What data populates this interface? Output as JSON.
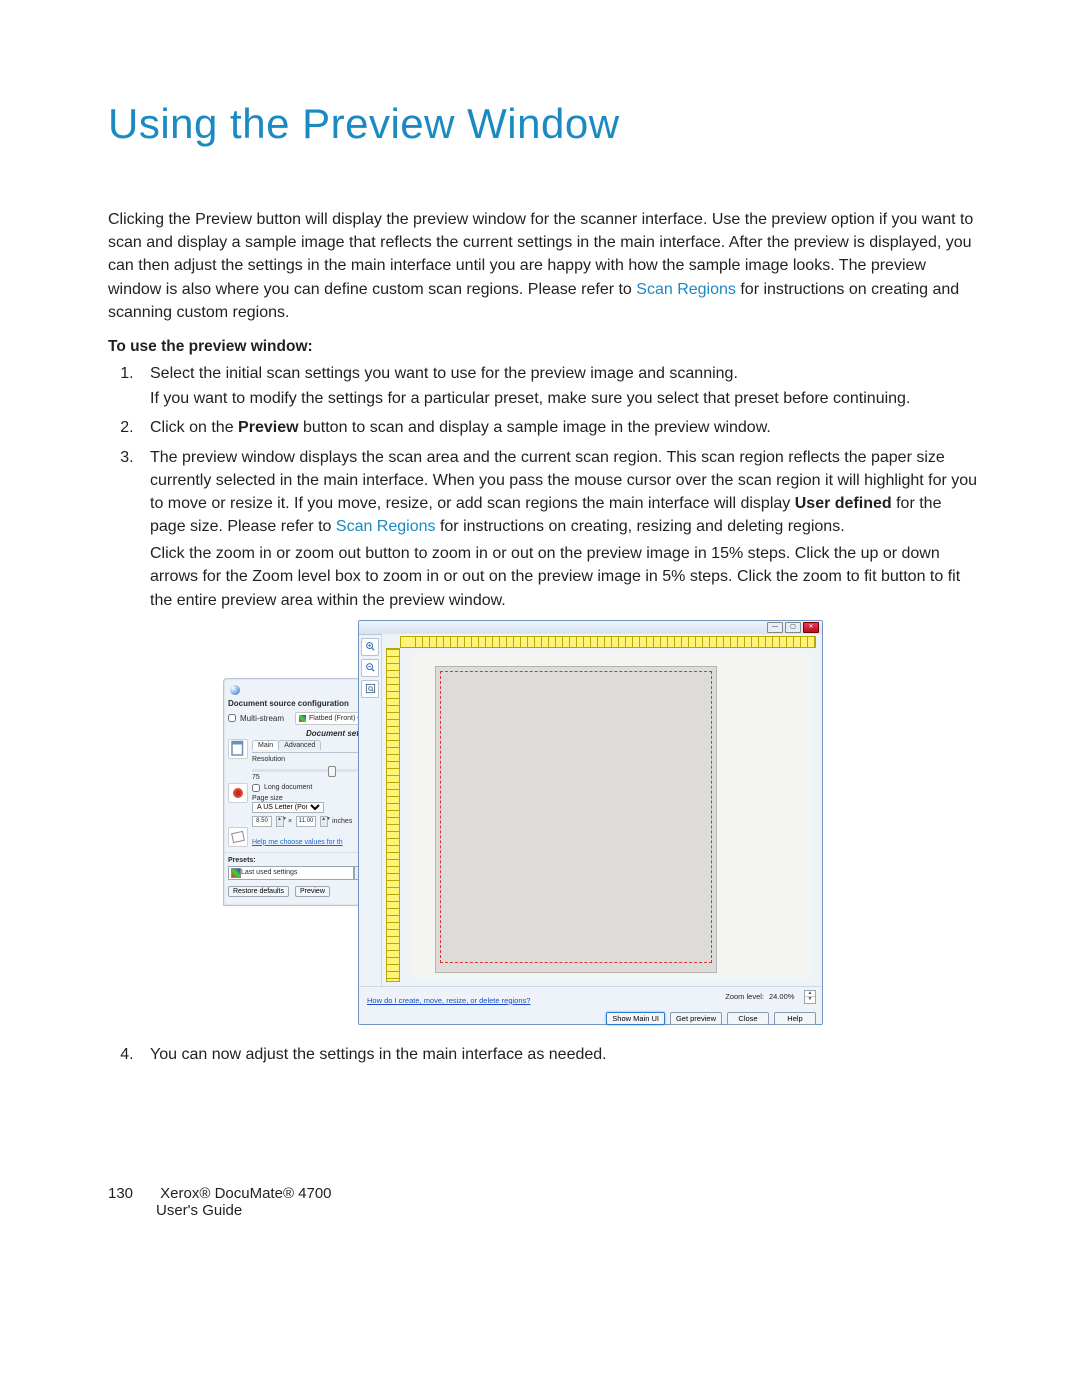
{
  "title": "Using the Preview Window",
  "intro": {
    "p1a": "Clicking the Preview button will display the preview window for the scanner interface. Use the preview option if you want to scan and display a sample image that reflects the current settings in the main interface. After the preview is displayed, you can then adjust the settings in the main interface until you are happy with how the sample image looks. The preview window is also where you can define custom scan regions. Please refer to ",
    "p1_link": "Scan Regions",
    "p1b": " for instructions on creating and scanning custom regions."
  },
  "sub_heading": "To use the preview window:",
  "steps": {
    "s1a": "Select the initial scan settings you want to use for the preview image and scanning.",
    "s1b": "If you want to modify the settings for a particular preset, make sure you select that preset before continuing.",
    "s2a": "Click on the ",
    "s2_bold": "Preview",
    "s2b": " button to scan and display a sample image in the preview window.",
    "s3a": "The preview window displays the scan area and the current scan region. This scan region reflects the paper size currently selected in the main interface. When you pass the mouse cursor over the scan region it will highlight for you to move or resize it. If you move, resize, or add scan regions the main interface will display ",
    "s3_bold": "User defined",
    "s3b": " for the page size. Please refer to ",
    "s3_link": "Scan Regions",
    "s3c": " for instructions on creating, resizing and deleting regions.",
    "s3_para2": "Click the zoom in or zoom out button to zoom in or out on the preview image in 15% steps.  Click the up or down arrows for the Zoom level box to zoom in or out on the preview image in 5% steps.  Click the zoom to fit button to fit the entire preview area within the preview window."
  },
  "settings_panel": {
    "section_title": "Document source configuration",
    "multistream_label": "Multi-stream",
    "flatbed_label": "Flatbed (Front) Color",
    "doc_settings": "Document settings",
    "tab_main": "Main",
    "tab_advanced": "Advanced",
    "resolution_label": "Resolution",
    "resolution_value": "75",
    "long_doc_label": "Long document",
    "pagesize_label": "Page size",
    "pagesize_value": "A  US Letter (Portrait)",
    "dim_w": "8.50",
    "dim_h": "11.00",
    "dim_unit": "inches",
    "multiply": "×",
    "help_link": "Help me choose values for th",
    "presets_label": "Presets:",
    "preset_value": "Last used settings",
    "restore_btn": "Restore defaults",
    "preview_btn": "Preview"
  },
  "preview_panel": {
    "help_link": "How do I create, move, resize, or delete regions?",
    "zoom_label": "Zoom level:",
    "zoom_value": "24.00%",
    "btn_showmain": "Show Main UI",
    "btn_getpreview": "Get preview",
    "btn_close": "Close",
    "btn_help": "Help"
  },
  "step4": "You can now adjust the settings in the main interface as needed.",
  "footer": {
    "page_num": "130",
    "product": "Xerox® DocuMate® 4700",
    "subtitle": "User's Guide"
  }
}
